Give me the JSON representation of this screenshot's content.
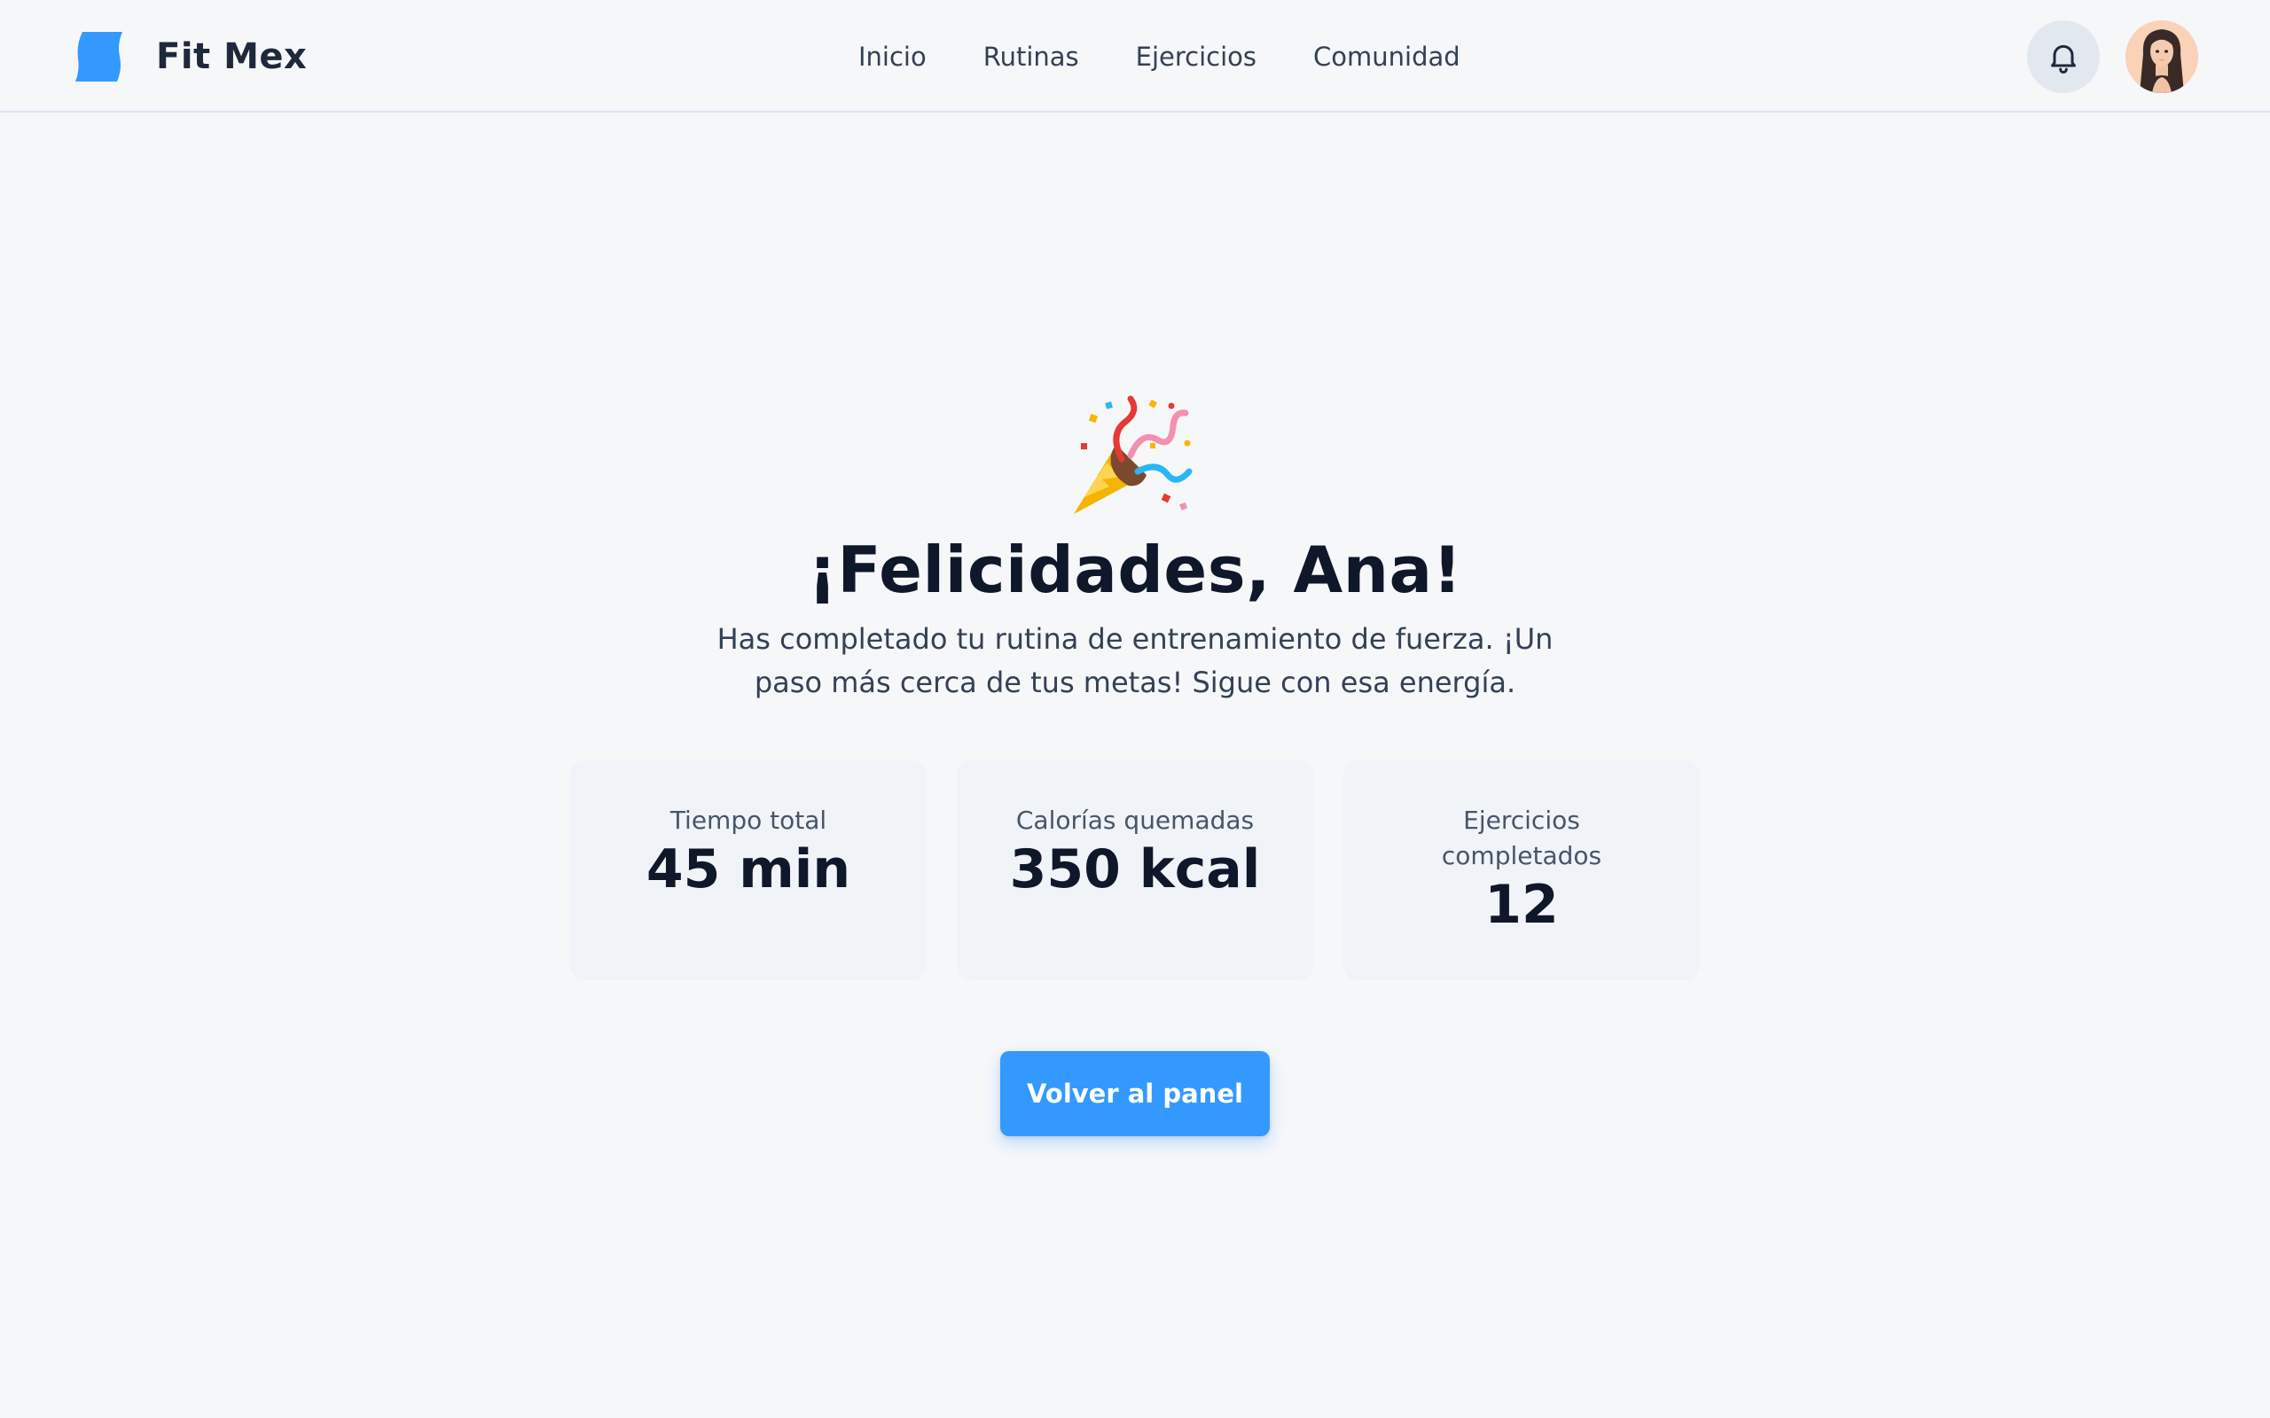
{
  "header": {
    "brand": "Fit Mex",
    "logo_icon": "flag-logo-icon",
    "nav": [
      {
        "label": "Inicio"
      },
      {
        "label": "Rutinas"
      },
      {
        "label": "Ejercicios"
      },
      {
        "label": "Comunidad"
      }
    ],
    "notification_icon": "bell-icon",
    "avatar_icon": "user-avatar"
  },
  "main": {
    "celebration_icon": "party-popper-icon",
    "headline": "¡Felicidades, Ana!",
    "subtitle": "Has completado tu rutina de entrenamiento de fuerza. ¡Un paso más cerca de tus metas! Sigue con esa energía.",
    "stats": [
      {
        "label": "Tiempo total",
        "value": "45 min"
      },
      {
        "label": "Calorías quemadas",
        "value": "350 kcal"
      },
      {
        "label": "Ejercicios completados",
        "value": "12"
      }
    ],
    "back_button": "Volver al panel"
  },
  "colors": {
    "accent": "#3399ff",
    "background": "#f6f7f9",
    "card": "#f0f4f8",
    "text_dark": "#0f172a",
    "text_muted": "#475569"
  }
}
